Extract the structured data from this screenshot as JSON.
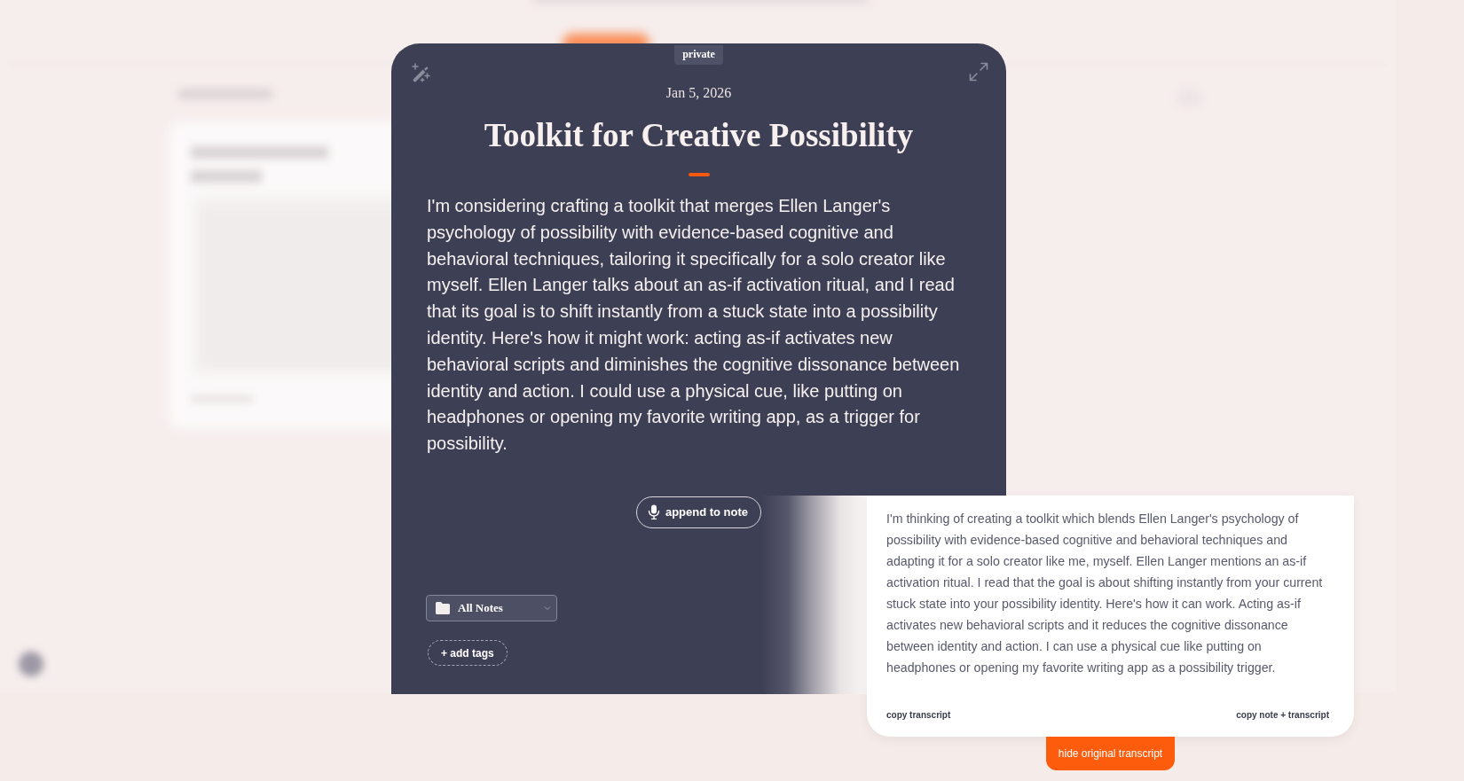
{
  "note": {
    "visibility": "private",
    "date": "Jan 5, 2026",
    "title": "Toolkit for Creative Possibility",
    "body": "I'm considering crafting a toolkit that merges Ellen Langer's psychology of possibility with evidence-based cognitive and behavioral techniques, tailoring it specifically for a solo creator like myself. Ellen Langer talks about an as-if activation ritual, and I read that its goal is to shift instantly from a stuck state into a possibility identity. Here's how it might work: acting as-if activates new behavioral scripts and diminishes the cognitive dissonance between identity and action. I could use a physical cue, like putting on headphones or opening my favorite writing app, as a trigger for possibility.",
    "append_button": "append to note",
    "folder_select": {
      "value": "All Notes"
    },
    "add_tags_button": "+ add tags"
  },
  "transcript": {
    "text": "I'm thinking of creating a toolkit which blends Ellen Langer's psychology of possibility with evidence-based cognitive and behavioral techniques and adapting it for a solo creator like me, myself. Ellen Langer mentions an as-if activation ritual. I read that the goal is about shifting instantly from your current stuck state into your possibility identity. Here's how it can work. Acting as-if activates new behavioral scripts and it reduces the cognitive dissonance between identity and action. I can use a physical cue like putting on headphones or opening my favorite writing app as a possibility trigger.",
    "actions": [
      {
        "label": "copy transcript"
      },
      {
        "label": "copy note + transcript"
      }
    ],
    "toggle_button": "hide original transcript"
  }
}
